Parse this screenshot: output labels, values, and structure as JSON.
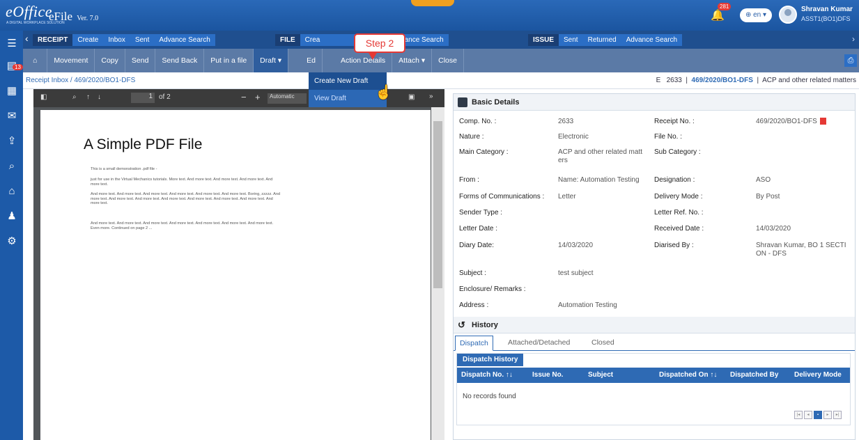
{
  "header": {
    "logo": "eOffice",
    "logo_tagline": "A DIGITAL WORKPLACE SOLUTION",
    "app_name": "eFile",
    "version": "Ver. 7.0",
    "notification_count": "281",
    "language": "en",
    "user_name": "Shravan Kumar",
    "user_designation": "ASST1(BO1)DFS"
  },
  "sidebar": {
    "badge": "13"
  },
  "menubar": {
    "receipt": {
      "group": "RECEIPT",
      "items": [
        "Create",
        "Inbox",
        "Sent",
        "Advance Search"
      ]
    },
    "file": {
      "group": "FILE",
      "items": [
        "Crea",
        "Advance Search"
      ]
    },
    "issue": {
      "group": "ISSUE",
      "items": [
        "Sent",
        "Returned",
        "Advance Search"
      ]
    }
  },
  "toolbar": {
    "home": "⌂",
    "items": [
      "Movement",
      "Copy",
      "Send",
      "Send Back",
      "Put in a file",
      "Draft ▾",
      "Ed",
      "Action Details",
      "Attach ▾",
      "Close"
    ]
  },
  "breadcrumb": "Receipt Inbox  /  469/2020/BO1-DFS",
  "file_id": {
    "prefix": "E",
    "comp": "2633",
    "receipt": "469/2020/BO1-DFS",
    "category": "ACP and other related matters"
  },
  "pdf": {
    "page_input": "1",
    "page_of": "of 2",
    "zoom": "Automatic",
    "title": "A Simple PDF File",
    "paragraphs": [
      "This is a small demonstration .pdf file -",
      "just for use in the Virtual Mechanics tutorials. More text. And more text. And more text. And more text. And more text.",
      "And more text. And more text. And more text. And more text. And more text. And more text. Boring, zzzzz. And more text. And more text. And more text. And more text. And more text. And more text. And more text. And more text.",
      "And more text. And more text. And more text. And more text. And more text. And more text. And more text. Even more. Continued on page 2 ..."
    ]
  },
  "draft_menu": {
    "items": [
      "Create New Draft",
      "View Draft"
    ]
  },
  "callout": "Step 2",
  "basic_details": {
    "title": "Basic Details",
    "rows": [
      {
        "l1": "Comp. No. :",
        "v1": "2633",
        "l2": "Receipt No. :",
        "v2": "469/2020/BO1-DFS"
      },
      {
        "l1": "Nature :",
        "v1": "Electronic",
        "l2": "File No. :",
        "v2": ""
      },
      {
        "l1": "Main Category :",
        "v1": "ACP and other related matt ers",
        "l2": "Sub Category :",
        "v2": ""
      },
      {
        "l1": "From :",
        "v1": "Name: Automation Testing",
        "l2": "Designation :",
        "v2": "ASO"
      },
      {
        "l1": "Forms of Communications :",
        "v1": "Letter",
        "l2": "Delivery Mode :",
        "v2": "By Post"
      },
      {
        "l1": "Sender Type :",
        "v1": "",
        "l2": "Letter Ref. No. :",
        "v2": ""
      },
      {
        "l1": "Letter Date :",
        "v1": "",
        "l2": "Received Date :",
        "v2": "14/03/2020"
      },
      {
        "l1": "Diary Date:",
        "v1": "14/03/2020",
        "l2": "Diarised By :",
        "v2": "Shravan Kumar, BO 1 SECTI ON - DFS"
      },
      {
        "l1": "Subject :",
        "v1": "test subject",
        "l2": "",
        "v2": ""
      },
      {
        "l1": "Enclosure/ Remarks :",
        "v1": "",
        "l2": "",
        "v2": ""
      },
      {
        "l1": "Address :",
        "v1": "Automation Testing",
        "l2": "",
        "v2": ""
      }
    ]
  },
  "history": {
    "title": "History",
    "tabs": [
      "Dispatch",
      "Attached/Detached",
      "Closed"
    ],
    "box_title": "Dispatch History",
    "columns": [
      "Dispatch No. ↑↓",
      "Issue No.",
      "Subject",
      "Dispatched On ↑↓",
      "Dispatched By",
      "Delivery Mode"
    ],
    "empty_text": "No records found"
  }
}
